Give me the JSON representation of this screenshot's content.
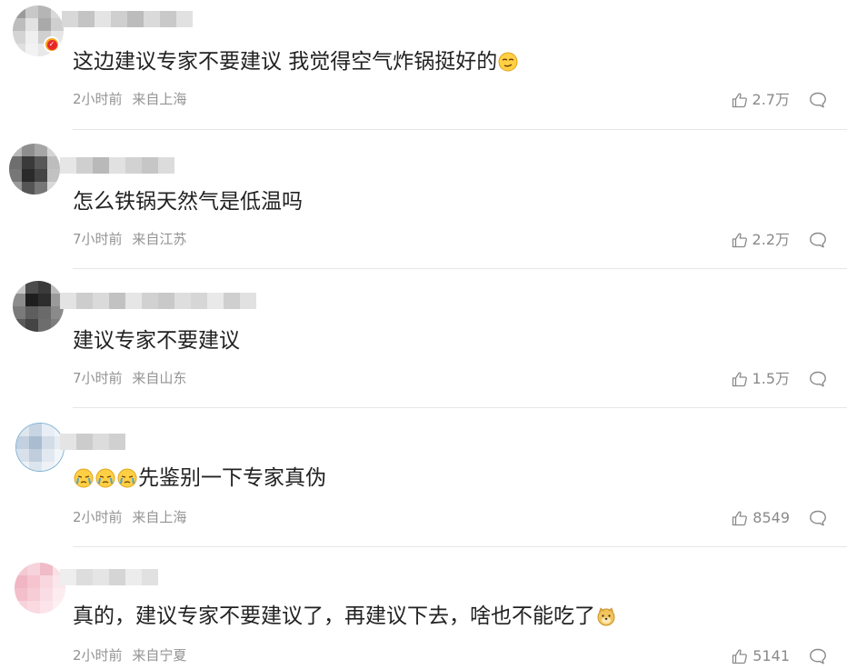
{
  "comments": [
    {
      "text": "这边建议专家不要建议 我觉得空气炸锅挺好的",
      "time": "2小时前",
      "location": "来自上海",
      "likes": "2.7万",
      "emoji_after": "smirk-emoji",
      "verified": true
    },
    {
      "text": "怎么铁锅天然气是低温吗",
      "time": "7小时前",
      "location": "来自江苏",
      "likes": "2.2万"
    },
    {
      "text": "建议专家不要建议",
      "time": "7小时前",
      "location": "来自山东",
      "likes": "1.5万"
    },
    {
      "text": "先鉴别一下专家真伪",
      "time": "2小时前",
      "location": "来自上海",
      "likes": "8549",
      "emoji_before": [
        "tears-emoji",
        "tears-emoji",
        "tears-emoji"
      ]
    },
    {
      "text": "真的，建议专家不要建议了，再建议下去，啥也不能吃了",
      "time": "2小时前",
      "location": "来自宁夏",
      "likes": "5141",
      "emoji_after": "doge-emoji"
    }
  ],
  "colors": {
    "meta_text": "#939393",
    "comment_text": "#222222",
    "divider": "#e6e6e6",
    "icon": "#8a8a8a"
  }
}
